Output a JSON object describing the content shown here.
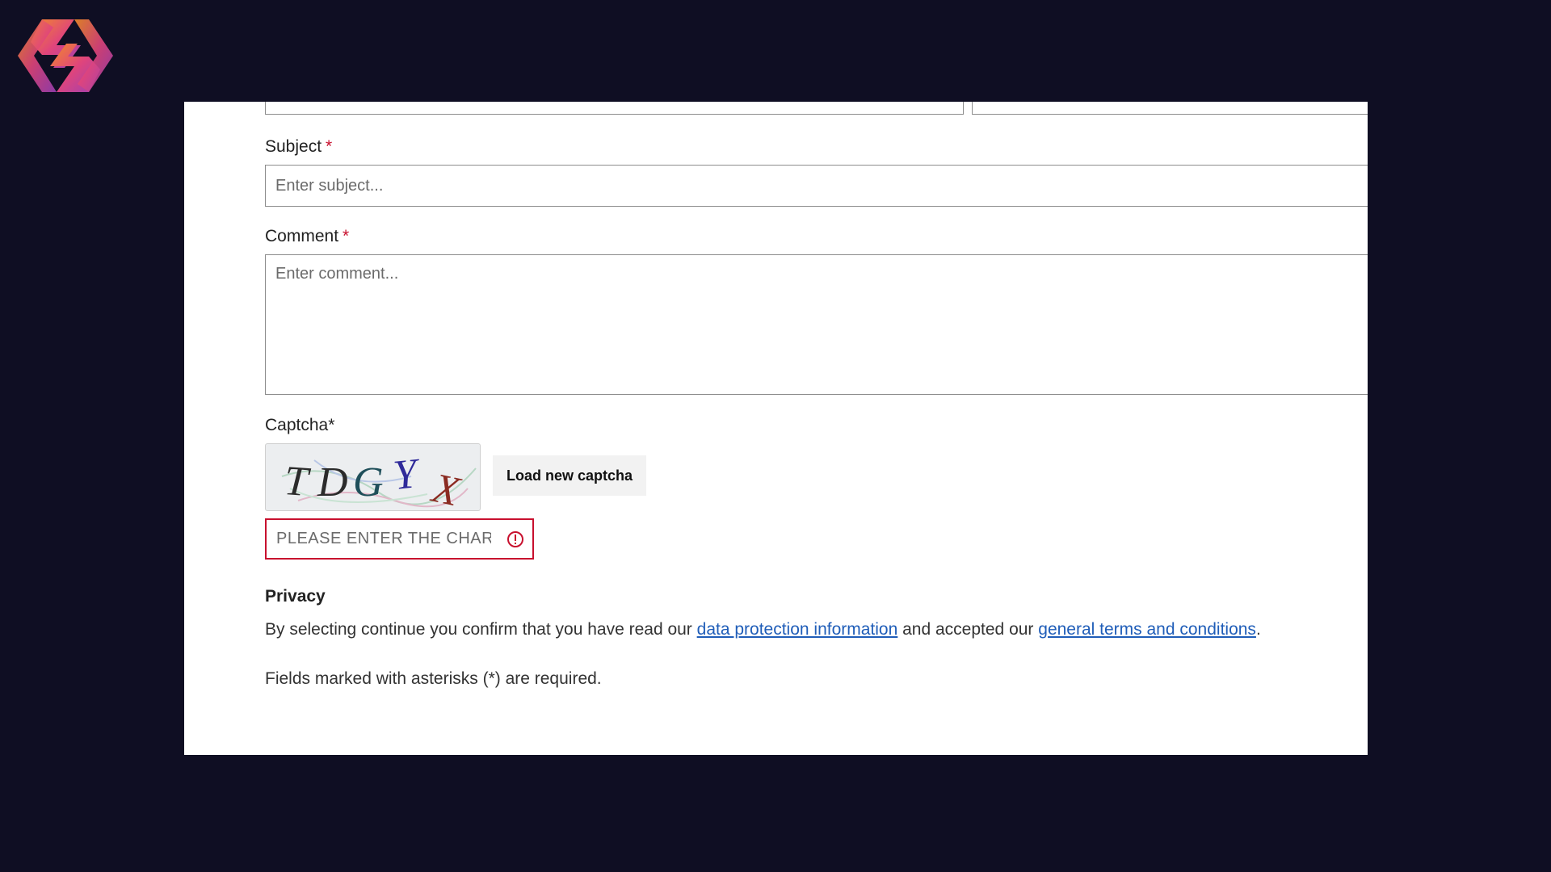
{
  "logo": {
    "name": "brand-logo",
    "colors": [
      "#f28c28",
      "#e0457b",
      "#9b3fb5"
    ]
  },
  "form": {
    "subject": {
      "label": "Subject",
      "required_mark": "*",
      "placeholder": "Enter subject..."
    },
    "comment": {
      "label": "Comment",
      "required_mark": "*",
      "placeholder": "Enter comment..."
    },
    "captcha": {
      "label": "Captcha*",
      "image_text": [
        "T",
        "D",
        "G",
        "Y",
        "X"
      ],
      "image_colors": [
        "#2b2b2b",
        "#2b2b2b",
        "#1f4f5a",
        "#2f2a9a",
        "#8b2b22"
      ],
      "load_button": "Load new captcha",
      "input_placeholder": "PLEASE ENTER THE CHARACTERS",
      "error_color": "#c8102e"
    }
  },
  "privacy": {
    "title": "Privacy",
    "text_before": "By selecting continue you confirm that you have read our ",
    "link1": "data protection information",
    "text_middle": " and accepted our ",
    "link2": "general terms and conditions",
    "text_after": "."
  },
  "required_note": "Fields marked with asterisks (*) are required."
}
